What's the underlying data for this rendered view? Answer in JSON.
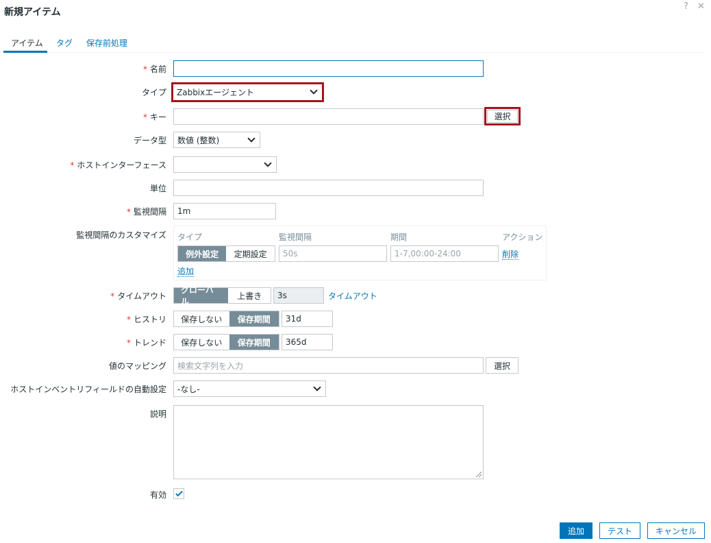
{
  "dialog": {
    "title": "新規アイテム",
    "help_glyph": "?",
    "close_glyph": "✕"
  },
  "tabs": [
    {
      "label": "アイテム",
      "active": true
    },
    {
      "label": "タグ",
      "active": false
    },
    {
      "label": "保存前処理",
      "active": false
    }
  ],
  "form": {
    "name": {
      "label": "名前",
      "required": true,
      "value": ""
    },
    "type": {
      "label": "タイプ",
      "selected": "Zabbixエージェント"
    },
    "key": {
      "label": "キー",
      "required": true,
      "value": "",
      "select_button": "選択"
    },
    "value_type": {
      "label": "データ型",
      "selected": "数値 (整数)"
    },
    "host_interface": {
      "label": "ホストインターフェース",
      "required": true,
      "selected": ""
    },
    "units": {
      "label": "単位",
      "value": ""
    },
    "update_interval": {
      "label": "監視間隔",
      "required": true,
      "value": "1m"
    },
    "custom_intervals": {
      "label": "監視間隔のカスタマイズ",
      "headers": {
        "type": "タイプ",
        "interval": "監視間隔",
        "period": "期間",
        "action": "アクション"
      },
      "row": {
        "type_options": [
          "例外設定",
          "定期設定"
        ],
        "type_selected": "例外設定",
        "interval_placeholder": "50s",
        "period_placeholder": "1-7,00:00-24:00",
        "remove": "削除"
      },
      "add": "追加"
    },
    "timeout": {
      "label": "タイムアウト",
      "required": true,
      "options": [
        "グローバル",
        "上書き"
      ],
      "selected": "グローバル",
      "value": "3s",
      "link": "タイムアウト"
    },
    "history": {
      "label": "ヒストリ",
      "required": true,
      "options": [
        "保存しない",
        "保存期間"
      ],
      "selected": "保存期間",
      "value": "31d"
    },
    "trends": {
      "label": "トレンド",
      "required": true,
      "options": [
        "保存しない",
        "保存期間"
      ],
      "selected": "保存期間",
      "value": "365d"
    },
    "value_mapping": {
      "label": "値のマッピング",
      "placeholder": "検索文字列を入力",
      "select_button": "選択"
    },
    "inventory": {
      "label": "ホストインベントリフィールドの自動設定",
      "selected": "-なし-"
    },
    "description": {
      "label": "説明",
      "value": ""
    },
    "enabled": {
      "label": "有効",
      "checked": true
    }
  },
  "footer": {
    "add": "追加",
    "test": "テスト",
    "cancel": "キャンセル"
  },
  "colors": {
    "accent": "#0275b8",
    "required": "#e33734",
    "highlight": "#a4141c",
    "segment_active": "#768d99"
  }
}
